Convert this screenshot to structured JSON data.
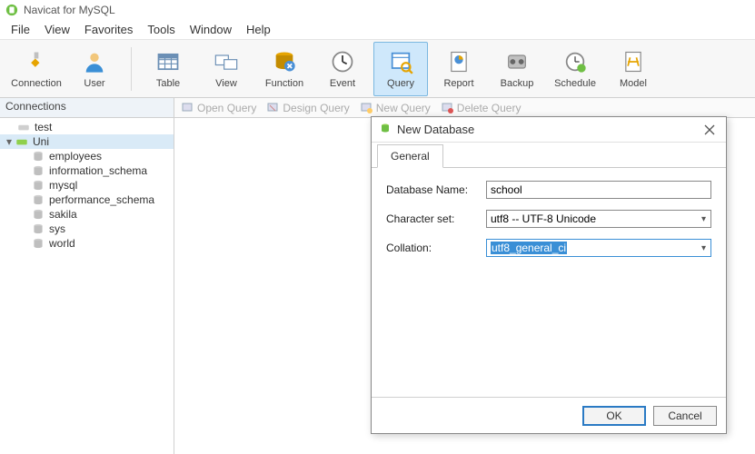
{
  "app": {
    "title": "Navicat for MySQL"
  },
  "menu": {
    "items": [
      "File",
      "View",
      "Favorites",
      "Tools",
      "Window",
      "Help"
    ]
  },
  "toolbar": {
    "connection": "Connection",
    "user": "User",
    "table": "Table",
    "view": "View",
    "function": "Function",
    "event": "Event",
    "query": "Query",
    "report": "Report",
    "backup": "Backup",
    "schedule": "Schedule",
    "model": "Model"
  },
  "subheader": {
    "connections": "Connections",
    "open_query": "Open Query",
    "design_query": "Design Query",
    "new_query": "New Query",
    "delete_query": "Delete Query"
  },
  "tree": {
    "test": "test",
    "uni": "Uni",
    "uni_children": [
      "employees",
      "information_schema",
      "mysql",
      "performance_schema",
      "sakila",
      "sys",
      "world"
    ]
  },
  "dialog": {
    "title": "New Database",
    "tab_general": "General",
    "label_dbname": "Database Name:",
    "value_dbname": "school",
    "label_charset": "Character set:",
    "value_charset": "utf8 -- UTF-8 Unicode",
    "label_collation": "Collation:",
    "value_collation": "utf8_general_ci",
    "ok": "OK",
    "cancel": "Cancel"
  }
}
